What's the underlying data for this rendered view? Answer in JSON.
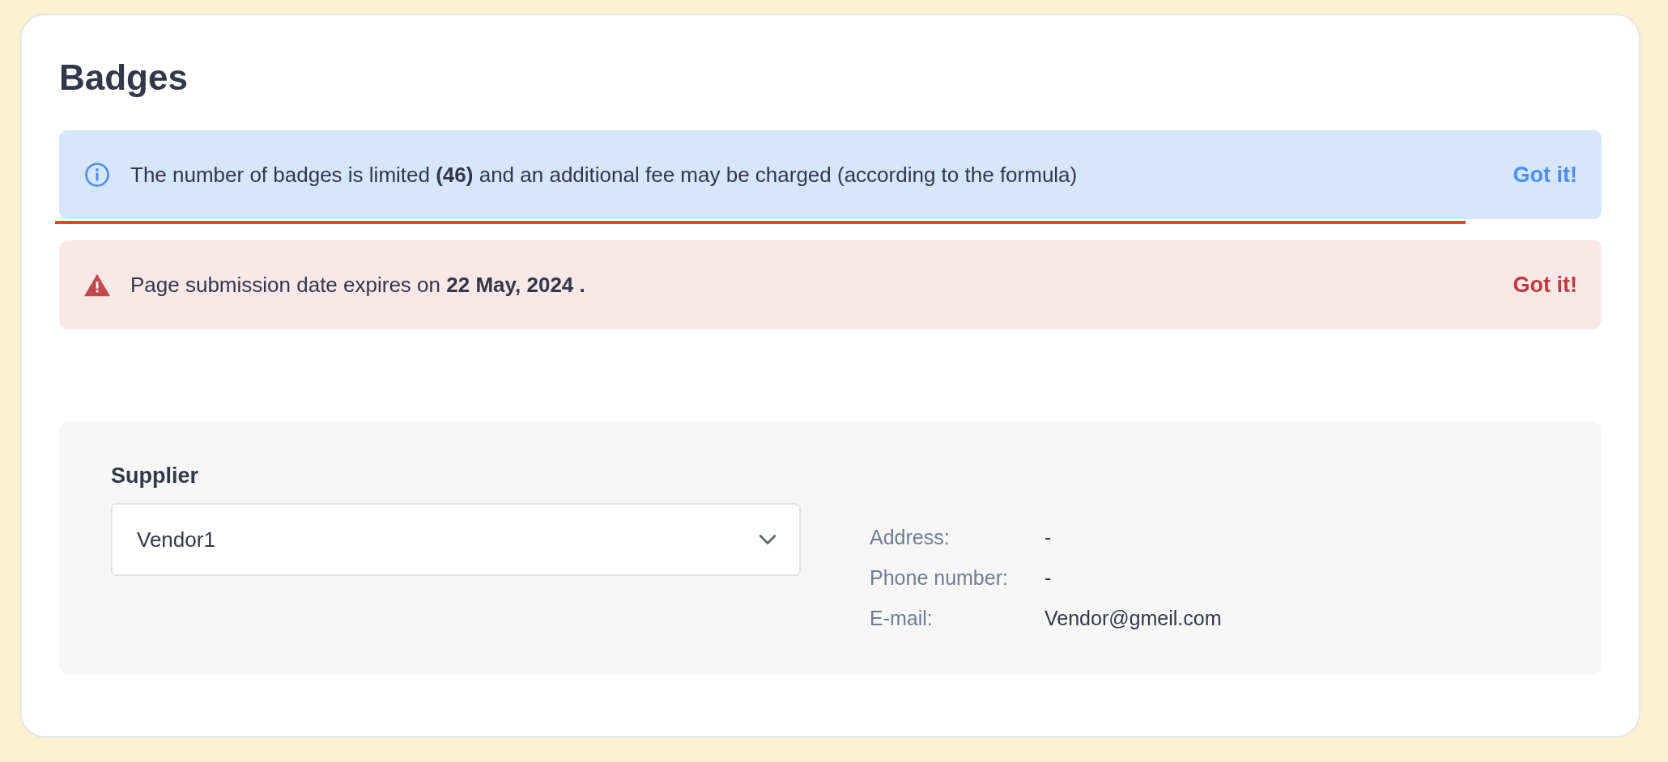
{
  "page": {
    "title": "Badges"
  },
  "alerts": [
    {
      "kind": "info",
      "message": "The number of badges is limited **(46)** and an additional fee may be charged (according to the formula)",
      "action": "Got it!"
    },
    {
      "kind": "warning",
      "message": "Page submission date expires on **22 May, 2024 .**",
      "action": "Got it!"
    }
  ],
  "supplier": {
    "label": "Supplier",
    "value": "Vendor1",
    "details": [
      {
        "label": "Address:",
        "value": "-"
      },
      {
        "label": "Phone number:",
        "value": "-"
      },
      {
        "label": "E-mail:",
        "value": "Vendor@gmeil.com"
      }
    ]
  }
}
